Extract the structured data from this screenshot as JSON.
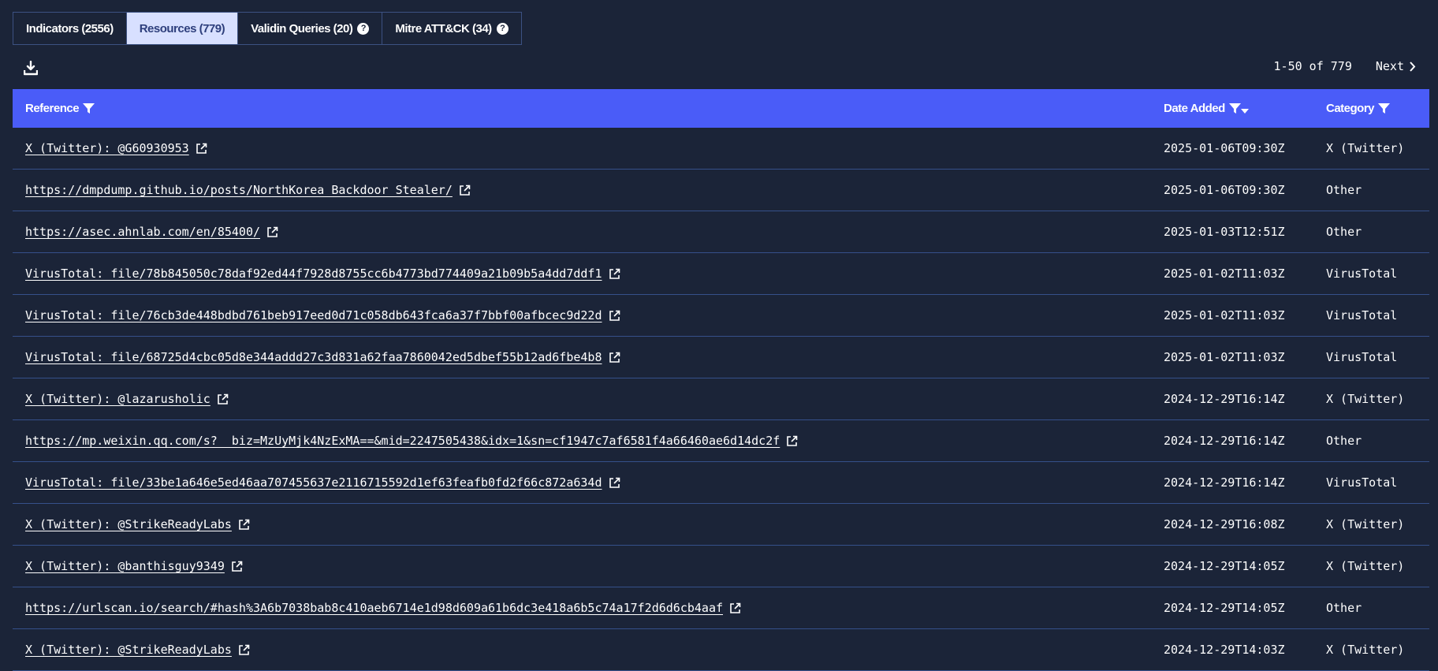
{
  "tabs": [
    {
      "label": "Indicators (2556)",
      "active": false,
      "help": false
    },
    {
      "label": "Resources (779)",
      "active": true,
      "help": false
    },
    {
      "label": "Validin Queries (20)",
      "active": false,
      "help": true
    },
    {
      "label": "Mitre ATT&CK (34)",
      "active": false,
      "help": true
    }
  ],
  "toolbar": {
    "download_icon": "download-icon",
    "range": "1-50 of 779",
    "next_label": "Next"
  },
  "table": {
    "headers": {
      "reference": "Reference",
      "date_added": "Date Added",
      "category": "Category"
    },
    "rows": [
      {
        "reference": "X (Twitter): @G60930953",
        "date": "2025-01-06T09:30Z",
        "category": "X (Twitter)"
      },
      {
        "reference": "https://dmpdump.github.io/posts/NorthKorea_Backdoor_Stealer/",
        "date": "2025-01-06T09:30Z",
        "category": "Other"
      },
      {
        "reference": "https://asec.ahnlab.com/en/85400/",
        "date": "2025-01-03T12:51Z",
        "category": "Other"
      },
      {
        "reference": "VirusTotal: file/78b845050c78daf92ed44f7928d8755cc6b4773bd774409a21b09b5a4dd7ddf1",
        "date": "2025-01-02T11:03Z",
        "category": "VirusTotal"
      },
      {
        "reference": "VirusTotal: file/76cb3de448bdbd761beb917eed0d71c058db643fca6a37f7bbf00afbcec9d22d",
        "date": "2025-01-02T11:03Z",
        "category": "VirusTotal"
      },
      {
        "reference": "VirusTotal: file/68725d4cbc05d8e344addd27c3d831a62faa7860042ed5dbef55b12ad6fbe4b8",
        "date": "2025-01-02T11:03Z",
        "category": "VirusTotal"
      },
      {
        "reference": "X (Twitter): @lazarusholic",
        "date": "2024-12-29T16:14Z",
        "category": "X (Twitter)"
      },
      {
        "reference": "https://mp.weixin.qq.com/s?__biz=MzUyMjk4NzExMA==&mid=2247505438&idx=1&sn=cf1947c7af6581f4a66460ae6d14dc2f",
        "date": "2024-12-29T16:14Z",
        "category": "Other"
      },
      {
        "reference": "VirusTotal: file/33be1a646e5ed46aa707455637e2116715592d1ef63feafb0fd2f66c872a634d",
        "date": "2024-12-29T16:14Z",
        "category": "VirusTotal"
      },
      {
        "reference": "X (Twitter): @StrikeReadyLabs",
        "date": "2024-12-29T16:08Z",
        "category": "X (Twitter)"
      },
      {
        "reference": "X (Twitter): @banthisguy9349",
        "date": "2024-12-29T14:05Z",
        "category": "X (Twitter)"
      },
      {
        "reference": "https://urlscan.io/search/#hash%3A6b7038bab8c410aeb6714e1d98d609a61b6dc3e418a6b5c74a17f2d6d6cb4aaf",
        "date": "2024-12-29T14:05Z",
        "category": "Other"
      },
      {
        "reference": "X (Twitter): @StrikeReadyLabs",
        "date": "2024-12-29T14:03Z",
        "category": "X (Twitter)"
      }
    ]
  },
  "colors": {
    "background": "#1b2438",
    "header": "#4a5cf8",
    "active_tab": "#d8e0ff",
    "row_border": "#35508a"
  }
}
